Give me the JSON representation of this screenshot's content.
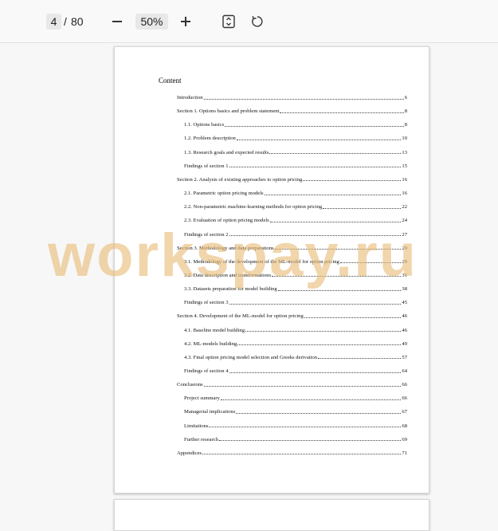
{
  "toolbar": {
    "current_page": "4",
    "separator": "/",
    "total_pages": "80",
    "zoom": "50%",
    "icons": [
      "minus-icon",
      "plus-icon",
      "fit-page-icon",
      "rotate-icon"
    ]
  },
  "document": {
    "heading": "Content",
    "toc": [
      {
        "text": "Introduction",
        "page": "6",
        "level": 1
      },
      {
        "text": "Section 1. Options basics and problem statement",
        "page": "8",
        "level": 1
      },
      {
        "text": "1.1. Options basics",
        "page": "8",
        "level": 2
      },
      {
        "text": "1.2. Problem description",
        "page": "10",
        "level": 2
      },
      {
        "text": "1.3. Research goals and expected results",
        "page": "13",
        "level": 2
      },
      {
        "text": "Findings of section 1",
        "page": "15",
        "level": 2
      },
      {
        "text": "Section 2. Analysis of existing approaches to option pricing",
        "page": "16",
        "level": 1
      },
      {
        "text": "2.1. Parametric option pricing models",
        "page": "16",
        "level": 2
      },
      {
        "text": "2.2. Non-parametric machine-learning methods for option pricing",
        "page": "22",
        "level": 2
      },
      {
        "text": "2.3. Evaluation of option pricing models",
        "page": "24",
        "level": 2
      },
      {
        "text": "Findings of section 2",
        "page": "27",
        "level": 2
      },
      {
        "text": "Section 3. Methodology and data preparations",
        "page": "29",
        "level": 1
      },
      {
        "text": "3.1. Methodology of the development of the ML-model for option pricing",
        "page": "29",
        "level": 2
      },
      {
        "text": "3.2. Data description and transformations",
        "page": "31",
        "level": 2
      },
      {
        "text": "3.3. Datasets preparation for model building",
        "page": "38",
        "level": 2
      },
      {
        "text": "Findings of section 3",
        "page": "45",
        "level": 2
      },
      {
        "text": "Section 4. Development of the ML-model for option pricing",
        "page": "46",
        "level": 1
      },
      {
        "text": "4.1. Baseline model building",
        "page": "46",
        "level": 2
      },
      {
        "text": "4.2. ML-models building",
        "page": "49",
        "level": 2
      },
      {
        "text": "4.3. Final option pricing model selection and Greeks derivation",
        "page": "57",
        "level": 2
      },
      {
        "text": "Findings of section 4",
        "page": "64",
        "level": 2
      },
      {
        "text": "Conclusions",
        "page": "66",
        "level": 1
      },
      {
        "text": "Project summary",
        "page": "66",
        "level": 2
      },
      {
        "text": "Managerial implications",
        "page": "67",
        "level": 2
      },
      {
        "text": "Limitations",
        "page": "68",
        "level": 2
      },
      {
        "text": "Further research",
        "page": "69",
        "level": 2
      },
      {
        "text": "Appendices",
        "page": "71",
        "level": 1
      }
    ],
    "watermark": "workspay.ru"
  }
}
